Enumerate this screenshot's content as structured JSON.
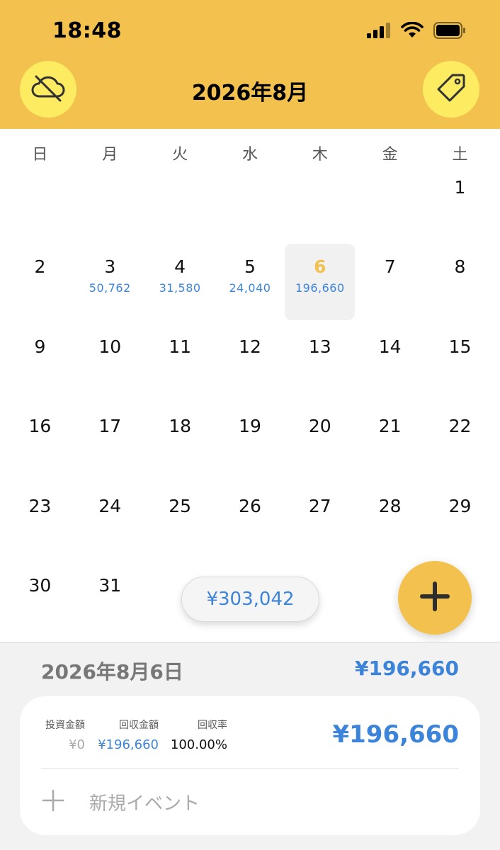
{
  "status_bar": {
    "time": "18:48"
  },
  "header": {
    "title": "2026年8月"
  },
  "weekdays": [
    "日",
    "月",
    "火",
    "水",
    "木",
    "金",
    "土"
  ],
  "calendar": {
    "weeks": [
      [
        {
          "day": ""
        },
        {
          "day": ""
        },
        {
          "day": ""
        },
        {
          "day": ""
        },
        {
          "day": ""
        },
        {
          "day": ""
        },
        {
          "day": "1"
        }
      ],
      [
        {
          "day": "2"
        },
        {
          "day": "3",
          "amount": "50,762"
        },
        {
          "day": "4",
          "amount": "31,580"
        },
        {
          "day": "5",
          "amount": "24,040"
        },
        {
          "day": "6",
          "amount": "196,660",
          "selected": true
        },
        {
          "day": "7"
        },
        {
          "day": "8"
        }
      ],
      [
        {
          "day": "9"
        },
        {
          "day": "10"
        },
        {
          "day": "11"
        },
        {
          "day": "12"
        },
        {
          "day": "13"
        },
        {
          "day": "14"
        },
        {
          "day": "15"
        }
      ],
      [
        {
          "day": "16"
        },
        {
          "day": "17"
        },
        {
          "day": "18"
        },
        {
          "day": "19"
        },
        {
          "day": "20"
        },
        {
          "day": "21"
        },
        {
          "day": "22"
        }
      ],
      [
        {
          "day": "23"
        },
        {
          "day": "24"
        },
        {
          "day": "25"
        },
        {
          "day": "26"
        },
        {
          "day": "27"
        },
        {
          "day": "28"
        },
        {
          "day": "29"
        }
      ],
      [
        {
          "day": "30"
        },
        {
          "day": "31"
        },
        {
          "day": ""
        },
        {
          "day": ""
        },
        {
          "day": ""
        },
        {
          "day": ""
        },
        {
          "day": ""
        }
      ]
    ]
  },
  "month_total": "¥303,042",
  "detail": {
    "date": "2026年8月6日",
    "total": "¥196,660",
    "investment_label": "投資金額",
    "investment_value": "¥0",
    "return_label": "回収金額",
    "return_value": "¥196,660",
    "rate_label": "回収率",
    "rate_value": "100.00%",
    "card_total": "¥196,660",
    "new_event_label": "新規イベント"
  },
  "colors": {
    "header": "#F3C14D",
    "circle_button": "#FDEC62",
    "accent_blue": "#3C84D9",
    "selected_day": "#F3C14D"
  },
  "icons": [
    "cloud-off-icon",
    "tag-icon",
    "plus-icon",
    "signal-icon",
    "wifi-icon",
    "battery-icon"
  ]
}
